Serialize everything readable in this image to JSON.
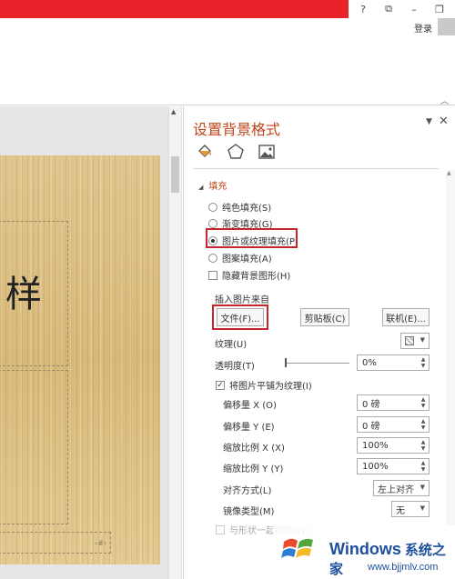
{
  "window": {
    "help_label": "?",
    "restore_label": "⧉",
    "minimize_label": "–",
    "maximize_label": "❐",
    "close_label": "✕",
    "login_label": "登录"
  },
  "slide": {
    "title_text": "样",
    "footer_text": "‹#›"
  },
  "pane": {
    "title": "设置背景格式",
    "tabs": [
      "fill-icon",
      "pentagon-icon",
      "picture-icon"
    ],
    "section_fill": "填充",
    "options": [
      {
        "label": "纯色填充(S)",
        "checked": false
      },
      {
        "label": "渐变填充(G)",
        "checked": false
      },
      {
        "label": "图片或纹理填充(P)",
        "checked": true
      },
      {
        "label": "图案填充(A)",
        "checked": false
      }
    ],
    "hide_bg_label": "隐藏背景图形(H)",
    "insert_from_label": "插入图片来自",
    "file_button": "文件(F)...",
    "clipboard_button": "剪贴板(C)",
    "online_button": "联机(E)...",
    "texture_label": "纹理(U)",
    "transparency_label": "透明度(T)",
    "transparency_value": "0%",
    "tile_label": "将图片平铺为纹理(I)",
    "offset_x_label": "偏移量 X (O)",
    "offset_x_value": "0 磅",
    "offset_y_label": "偏移量 Y (E)",
    "offset_y_value": "0 磅",
    "scale_x_label": "缩放比例 X (X)",
    "scale_x_value": "100%",
    "scale_y_label": "缩放比例 Y (Y)",
    "scale_y_value": "100%",
    "align_label": "对齐方式(L)",
    "align_value": "左上对齐",
    "mirror_label": "镜像类型(M)",
    "mirror_value": "无",
    "rotate_label": "与形状一起旋转(W)"
  },
  "watermark": {
    "brand": "Windows",
    "brand_cn": "系统之家",
    "url": "www.bjjmlv.com"
  },
  "colors": {
    "title_bar_red": "#e8242a",
    "accent_orange": "#c2441c",
    "highlight_red": "#c4262e",
    "watermark_blue": "#1d4f9c"
  }
}
